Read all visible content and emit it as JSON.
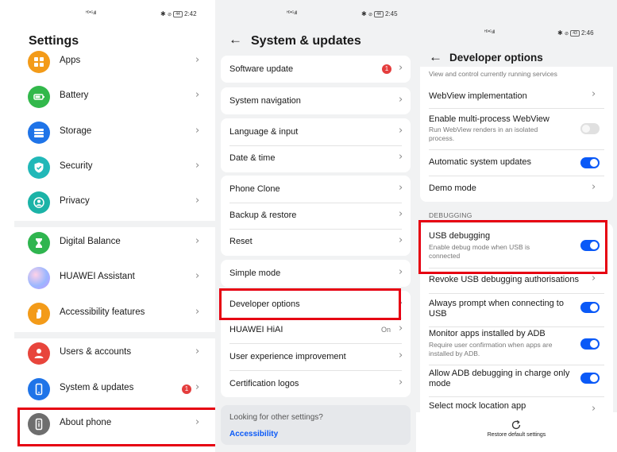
{
  "colors": {
    "accent": "#0a59f7",
    "highlight": "#e60012",
    "badge": "#e43d3d"
  },
  "chevron": "›",
  "panel1": {
    "status": {
      "network": "ᴴᴰ⁴ᴳ.ıll",
      "bluetooth": "✱",
      "silent": "🔕",
      "battery": "44",
      "time": "2:42"
    },
    "title": "Settings",
    "items": [
      {
        "label": "Apps",
        "icon": "apps-icon",
        "color": "#f39b19"
      },
      {
        "label": "Battery",
        "icon": "battery-icon",
        "color": "#32b84b"
      },
      {
        "label": "Storage",
        "icon": "storage-icon",
        "color": "#1f74e8"
      },
      {
        "label": "Security",
        "icon": "shield-icon",
        "color": "#21b8b8"
      },
      {
        "label": "Privacy",
        "icon": "privacy-icon",
        "color": "#1bb3a7"
      },
      {
        "label": "Digital Balance",
        "icon": "hourglass-icon",
        "color": "#2fb54f"
      },
      {
        "label": "HUAWEI Assistant",
        "icon": "assistant-icon",
        "color": "#b48ce6"
      },
      {
        "label": "Accessibility features",
        "icon": "hand-icon",
        "color": "#f39b19"
      },
      {
        "label": "Users & accounts",
        "icon": "user-icon",
        "color": "#e8453c"
      },
      {
        "label": "System & updates",
        "icon": "phone-icon",
        "color": "#1f74e8",
        "badge": "1"
      },
      {
        "label": "About phone",
        "icon": "info-phone-icon",
        "color": "#6e6e6e"
      }
    ]
  },
  "panel2": {
    "status": {
      "network": "ᴴᴰ⁴ᴳ.ıll",
      "bluetooth": "✱",
      "silent": "🔕",
      "battery": "44",
      "time": "2:45"
    },
    "title": "System & updates",
    "back": "←",
    "items": [
      {
        "label": "Software update",
        "badge": "1"
      },
      {
        "label": "System navigation"
      },
      {
        "label": "Language & input"
      },
      {
        "label": "Date & time"
      },
      {
        "label": "Phone Clone"
      },
      {
        "label": "Backup & restore"
      },
      {
        "label": "Reset"
      },
      {
        "label": "Simple mode"
      },
      {
        "label": "Developer options"
      },
      {
        "label": "HUAWEI HiAI",
        "value": "On"
      },
      {
        "label": "User experience improvement"
      },
      {
        "label": "Certification logos"
      }
    ],
    "suggestion": {
      "text": "Looking for other settings?",
      "link": "Accessibility"
    }
  },
  "panel3": {
    "status": {
      "network": "ᴴᴰ⁴ᴳ.ıll",
      "bluetooth": "✱",
      "silent": "🔕",
      "battery": "43",
      "time": "2:46"
    },
    "title": "Developer options",
    "back": "←",
    "cut_text": "View and control currently running services",
    "items": [
      {
        "label": "WebView implementation"
      },
      {
        "label": "Enable multi-process WebView",
        "sub": "Run WebView renders in an isolated process.",
        "toggle": false
      },
      {
        "label": "Automatic system updates",
        "toggle": true
      },
      {
        "label": "Demo mode"
      }
    ],
    "section": "DEBUGGING",
    "debug_items": [
      {
        "label": "USB debugging",
        "sub": "Enable debug mode when USB is connected",
        "toggle": true
      },
      {
        "label": "Revoke USB debugging authorisations"
      },
      {
        "label": "Always prompt when connecting to USB",
        "toggle": true
      },
      {
        "label": "Monitor apps installed by ADB",
        "sub": "Require user confirmation when apps are installed by ADB.",
        "toggle": true
      },
      {
        "label": "Allow ADB debugging in charge only mode",
        "toggle": true
      },
      {
        "label": "Select mock location app"
      }
    ],
    "restore": {
      "label": "Restore default settings",
      "icon": "restore-icon"
    }
  }
}
